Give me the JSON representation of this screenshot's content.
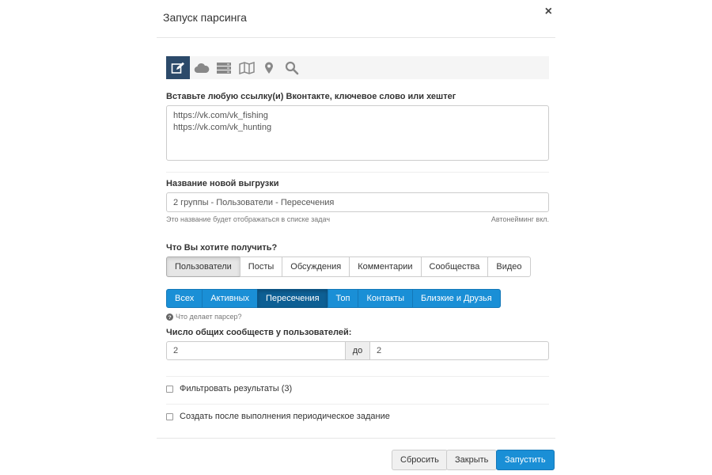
{
  "modal": {
    "title": "Запуск парсинга",
    "close": "×"
  },
  "toolbar": {
    "icons": [
      "edit-icon",
      "cloud-icon",
      "server-icon",
      "map-icon",
      "map-marker-icon",
      "search-icon"
    ],
    "active_color": "#2c4a6a"
  },
  "links": {
    "label": "Вставьте любую ссылку(и) Вконтакте, ключевое слово или хештег",
    "value": "https://vk.com/vk_fishing\nhttps://vk.com/vk_hunting"
  },
  "export_name": {
    "label": "Название новой выгрузки",
    "value": "2 группы - Пользователи - Пересечения",
    "hint_left": "Это название будет отображаться в списке задач",
    "hint_right": "Автонейминг вкл."
  },
  "what_to_get": {
    "label": "Что Вы хотите получить?",
    "options": [
      "Пользователи",
      "Посты",
      "Обсуждения",
      "Комментарии",
      "Сообщества",
      "Видео"
    ],
    "selected": "Пользователи"
  },
  "mode": {
    "options": [
      "Всех",
      "Активных",
      "Пересечения",
      "Топ",
      "Контакты",
      "Близкие и Друзья"
    ],
    "selected": "Пересечения",
    "help": "Что делает парсер?"
  },
  "common_groups": {
    "label": "Число общих сообществ у пользователей:",
    "from": "2",
    "sep": "до",
    "to": "2"
  },
  "options": {
    "filter": "Фильтровать результаты (3)",
    "periodic": "Создать после выполнения периодическое задание"
  },
  "footer": {
    "reset": "Сбросить",
    "close": "Закрыть",
    "start": "Запустить"
  },
  "colors": {
    "primary": "#1a8fd6",
    "primary_dark": "#0d5f94"
  }
}
